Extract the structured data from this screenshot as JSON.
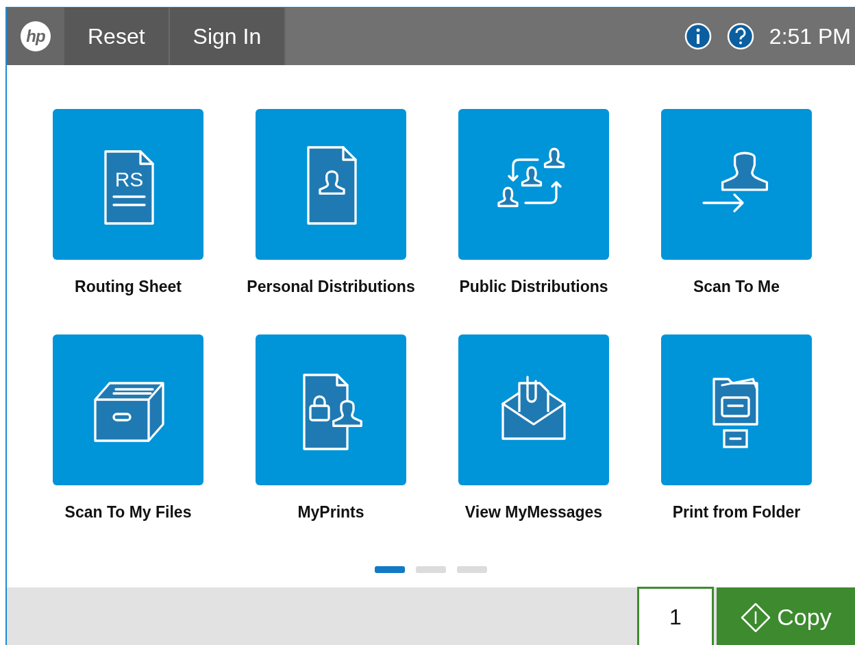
{
  "top_bar": {
    "logo": "hp",
    "buttons": [
      {
        "label": "Reset"
      },
      {
        "label": "Sign In"
      }
    ],
    "time": "2:51 PM"
  },
  "tiles": [
    {
      "label": "Routing Sheet",
      "kind": "routing-sheet",
      "icon_text": "RS"
    },
    {
      "label": "Personal Distributions",
      "kind": "personal"
    },
    {
      "label": "Public Distributions",
      "kind": "public"
    },
    {
      "label": "Scan To Me",
      "kind": "scan-to-me"
    },
    {
      "label": "Scan To My Files",
      "kind": "box"
    },
    {
      "label": "MyPrints",
      "kind": "lock-document"
    },
    {
      "label": "View MyMessages",
      "kind": "envelope"
    },
    {
      "label": "Print from Folder",
      "kind": "folder-print"
    }
  ],
  "pages": [
    {
      "selected": true
    },
    {
      "selected": false
    },
    {
      "selected": false
    }
  ],
  "bottom_bar": {
    "copies": "1",
    "copy_button": "Copy"
  }
}
